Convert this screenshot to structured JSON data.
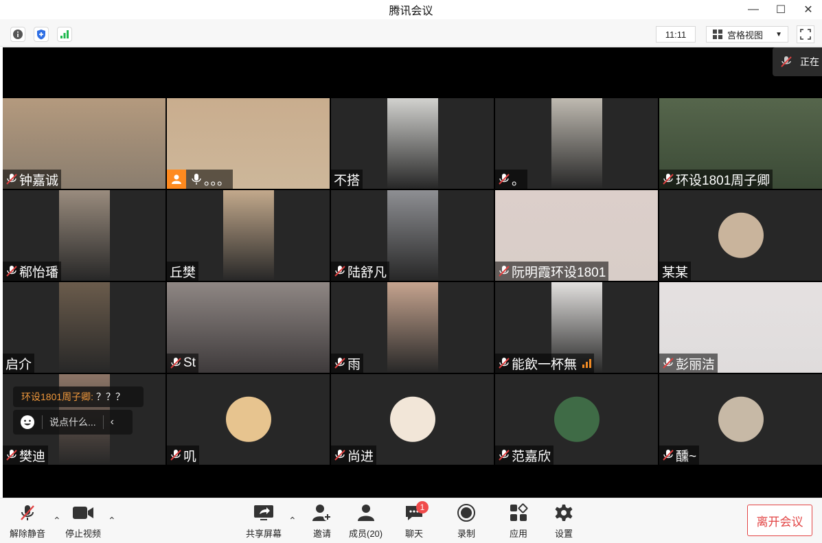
{
  "window": {
    "title": "腾讯会议"
  },
  "toolbar": {
    "clock": "11:11",
    "view_mode": "宫格视图"
  },
  "speaking": {
    "label": "正在"
  },
  "colors": {
    "accent_orange": "#ff8a1f",
    "active_border": "#27a35f",
    "leave_red": "#e24444"
  },
  "participants": [
    {
      "name": "钟嘉诚",
      "muted": true,
      "bg": "#8a7d6e",
      "video": "#b49a7e"
    },
    {
      "name": "。。。",
      "muted": false,
      "host": true,
      "active": true,
      "bg": "#cdb79a",
      "video": "#c9ad8e"
    },
    {
      "name": "不搭",
      "muted": false,
      "bg": "#272727",
      "video": "#d2d2cf"
    },
    {
      "name": "。",
      "muted": true,
      "bg": "#272727",
      "video": "#bfbab1"
    },
    {
      "name": "环设1801周子卿",
      "muted": true,
      "bg": "#3b4a36",
      "video": "#56664c"
    },
    {
      "name": "郗怡璠",
      "muted": true,
      "bg": "#272727",
      "video": "#9a8c7e"
    },
    {
      "name": "丘樊",
      "muted": false,
      "bg": "#272727",
      "video": "#c3a98c"
    },
    {
      "name": "陆舒凡",
      "muted": true,
      "bg": "#272727",
      "video": "#8e8f93"
    },
    {
      "name": "阮明霞环设1801",
      "muted": true,
      "bg": "#d8cdc8",
      "video": "#dccfca"
    },
    {
      "name": "某某",
      "muted": false,
      "avatar": true,
      "bg": "#272727",
      "avatar_color": "#c9b49c"
    },
    {
      "name": "启介",
      "muted": false,
      "bg": "#272727",
      "video": "#6b5c4c"
    },
    {
      "name": "St",
      "muted": true,
      "bg": "#3e3a3b",
      "video": "#8f8784"
    },
    {
      "name": "雨",
      "muted": true,
      "bg": "#272727",
      "video": "#c6a48f"
    },
    {
      "name": "能飲一杯無",
      "muted": true,
      "signal": true,
      "bg": "#272727",
      "video": "#e3e1df"
    },
    {
      "name": "彭丽洁",
      "muted": true,
      "bg": "#dfdcdc",
      "video": "#e5e1e1"
    },
    {
      "name": "樊迪",
      "muted": true,
      "bg": "#272727",
      "video": "#8d7567"
    },
    {
      "name": "叽",
      "muted": true,
      "avatar": true,
      "bg": "#272727",
      "avatar_color": "#e7c48f"
    },
    {
      "name": "尚进",
      "muted": true,
      "avatar": true,
      "bg": "#272727",
      "avatar_color": "#f2e6d8"
    },
    {
      "name": "范嘉欣",
      "muted": true,
      "avatar": true,
      "bg": "#272727",
      "avatar_color": "#3f6b46"
    },
    {
      "name": "醺~",
      "muted": true,
      "avatar": true,
      "bg": "#272727",
      "avatar_color": "#c7b9a6"
    }
  ],
  "chat": {
    "sender": "环设1801周子卿:",
    "message": "？？？",
    "placeholder": "说点什么..."
  },
  "controls": {
    "unmute": "解除静音",
    "stop_video": "停止视频",
    "share": "共享屏幕",
    "invite": "邀请",
    "members": "成员(20)",
    "chat": "聊天",
    "chat_badge": "1",
    "record": "录制",
    "apps": "应用",
    "settings": "设置",
    "leave": "离开会议"
  }
}
